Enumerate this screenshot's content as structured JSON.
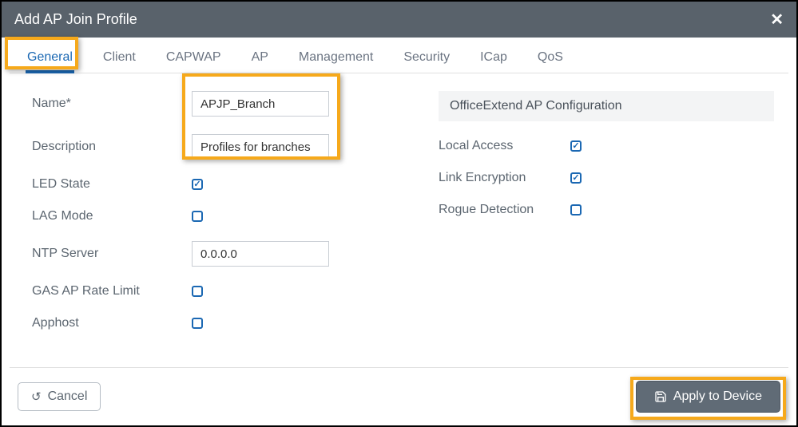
{
  "title": "Add AP Join Profile",
  "tabs": [
    "General",
    "Client",
    "CAPWAP",
    "AP",
    "Management",
    "Security",
    "ICap",
    "QoS"
  ],
  "active_tab_index": 0,
  "left": {
    "name_label": "Name*",
    "name_value": "APJP_Branch",
    "desc_label": "Description",
    "desc_value": "Profiles for branches",
    "led_label": "LED State",
    "led_checked": true,
    "lag_label": "LAG Mode",
    "lag_checked": false,
    "ntp_label": "NTP Server",
    "ntp_value": "0.0.0.0",
    "gas_label": "GAS AP Rate Limit",
    "gas_checked": false,
    "apphost_label": "Apphost",
    "apphost_checked": false
  },
  "right": {
    "section_title": "OfficeExtend AP Configuration",
    "local_label": "Local Access",
    "local_checked": true,
    "link_label": "Link Encryption",
    "link_checked": true,
    "rogue_label": "Rogue Detection",
    "rogue_checked": false
  },
  "footer": {
    "cancel": "Cancel",
    "apply": "Apply to Device"
  },
  "colors": {
    "accent": "#1b68b3",
    "highlight": "#f6a91b",
    "titlebar": "#59626b"
  }
}
